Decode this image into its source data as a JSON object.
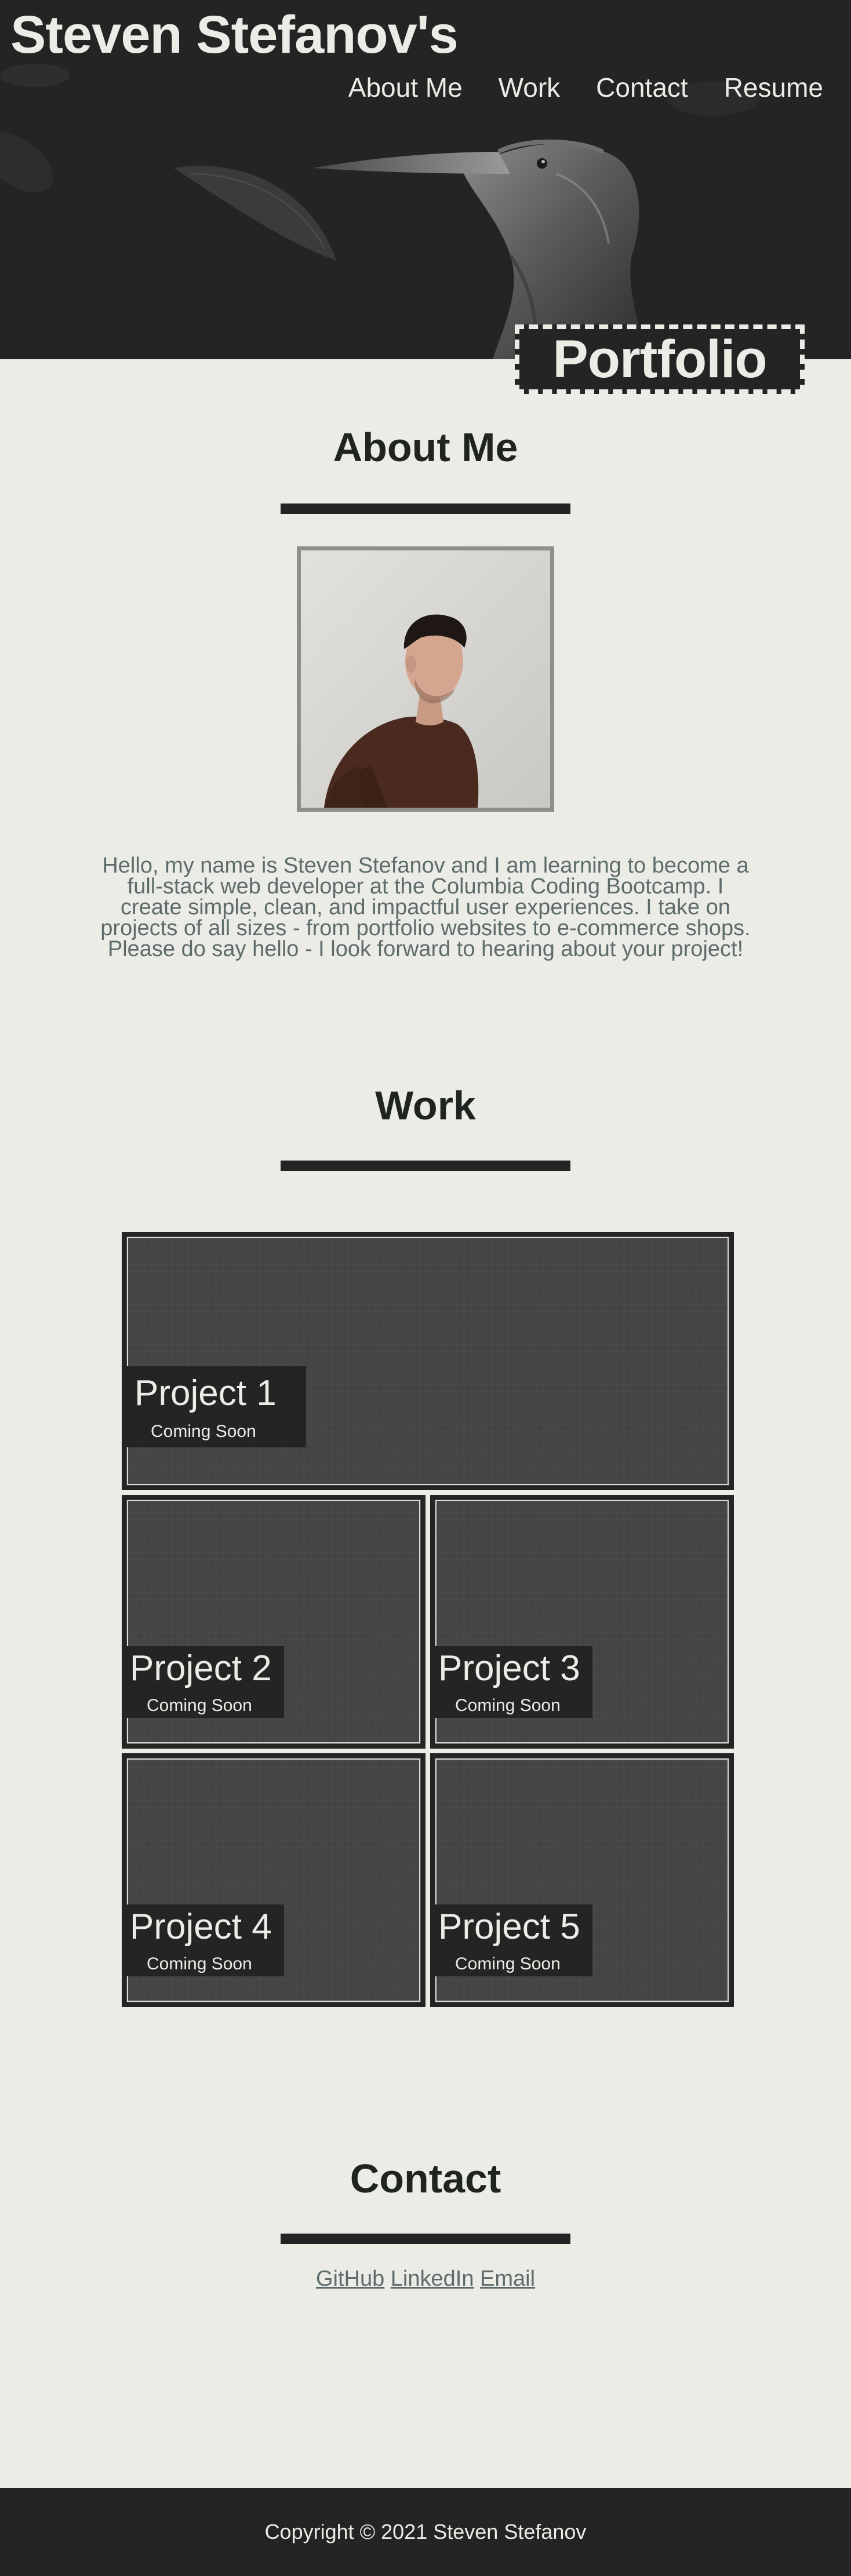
{
  "header": {
    "site_title": "Steven Stefanov's",
    "nav": [
      {
        "label": "About Me"
      },
      {
        "label": "Work"
      },
      {
        "label": "Contact"
      },
      {
        "label": "Resume"
      }
    ],
    "badge": "Portfolio",
    "hero_image": "heron-image"
  },
  "about": {
    "title": "About Me",
    "photo": "profile-photo",
    "text": "Hello, my name is Steven Stefanov and I am learning to become a full-stack web developer at the Columbia Coding Bootcamp. I create simple, clean, and impactful user experiences. I take on projects of all sizes - from portfolio websites to e-commerce shops. Please do say hello - I look forward to hearing about your project!"
  },
  "work": {
    "title": "Work",
    "projects": [
      {
        "title": "Project 1",
        "subtitle": "Coming Soon"
      },
      {
        "title": "Project 2",
        "subtitle": "Coming Soon"
      },
      {
        "title": "Project 3",
        "subtitle": "Coming Soon"
      },
      {
        "title": "Project 4",
        "subtitle": "Coming Soon"
      },
      {
        "title": "Project 5",
        "subtitle": "Coming Soon"
      }
    ]
  },
  "contact": {
    "title": "Contact",
    "links": [
      {
        "label": "GitHub"
      },
      {
        "label": "LinkedIn"
      },
      {
        "label": "Email"
      }
    ]
  },
  "footer": {
    "copyright": "Copyright © 2021 Steven Stefanov"
  },
  "colors": {
    "dark": "#242424",
    "background": "#ecece6",
    "text_muted": "#5d6b6b",
    "heading": "#1f2421"
  }
}
